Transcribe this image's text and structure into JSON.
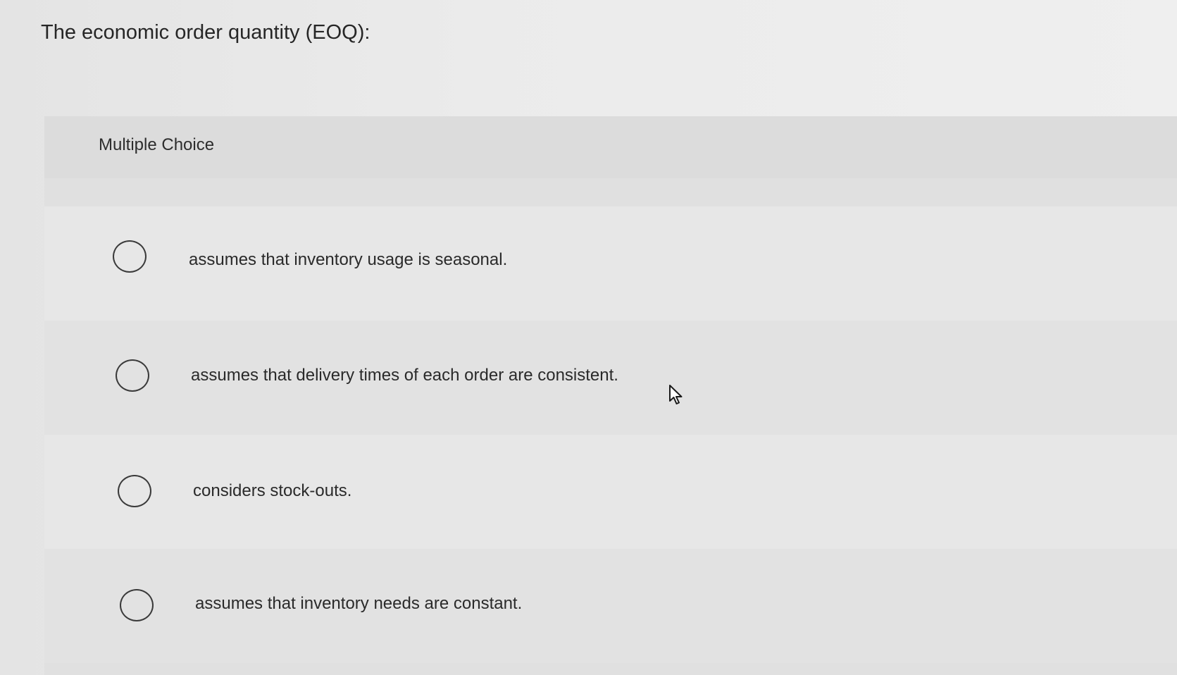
{
  "question": {
    "text": "The economic order quantity (EOQ):"
  },
  "panel": {
    "label": "Multiple Choice"
  },
  "options": [
    {
      "label": "assumes that inventory usage is seasonal.",
      "selected": false
    },
    {
      "label": "assumes that delivery times of each order are consistent.",
      "selected": false
    },
    {
      "label": "considers stock-outs.",
      "selected": false
    },
    {
      "label": "assumes that inventory needs are constant.",
      "selected": false
    }
  ],
  "icons": {
    "radio": "radio-button-icon",
    "cursor": "mouse-pointer-icon"
  },
  "colors": {
    "background": "#e9e9e9",
    "panel": "#e0e0e0",
    "text": "#2a2a2a",
    "radio_border": "#3a3a3a"
  }
}
